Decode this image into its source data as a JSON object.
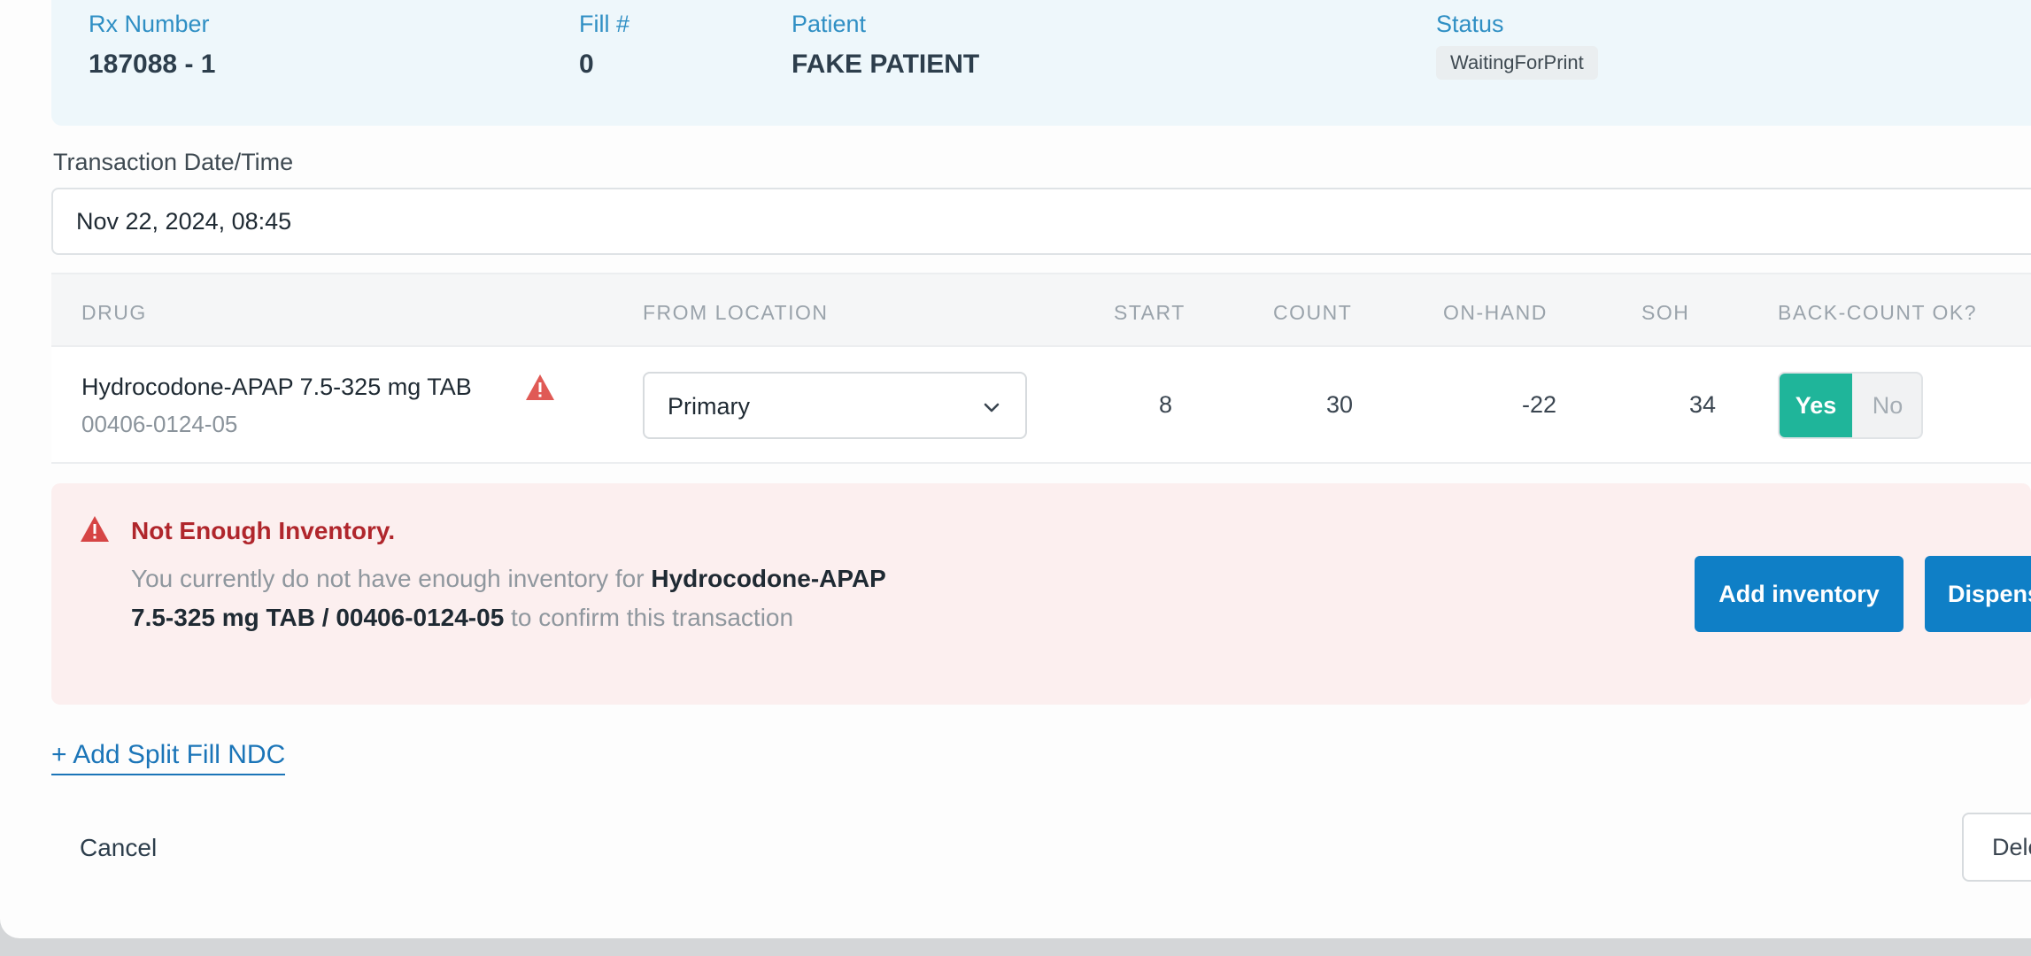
{
  "rx_header": {
    "rx_number_label": "Rx Number",
    "rx_number_value": "187088 - 1",
    "fill_label": "Fill #",
    "fill_value": "0",
    "patient_label": "Patient",
    "patient_value": "FAKE PATIENT",
    "status_label": "Status",
    "status_value": "WaitingForPrint"
  },
  "transaction": {
    "label": "Transaction Date/Time",
    "value": "Nov 22, 2024, 08:45"
  },
  "table": {
    "headers": [
      "DRUG",
      "FROM LOCATION",
      "START",
      "COUNT",
      "ON-HAND",
      "SOH",
      "BACK-COUNT OK?"
    ],
    "rows": [
      {
        "drug_name": "Hydrocodone-APAP 7.5-325 mg TAB",
        "ndc": "00406-0124-05",
        "from_location": "Primary",
        "start": "8",
        "count": "30",
        "on_hand": "-22",
        "soh": "34",
        "backcount_yes": "Yes",
        "backcount_no": "No",
        "backcount_selected": "Yes",
        "warning_icon": "warning-triangle-icon"
      }
    ]
  },
  "alert": {
    "title": "Not Enough Inventory.",
    "message_prefix": "You currently do not have enough inventory for ",
    "message_bold": "Hydrocodone-APAP 7.5-325 mg TAB / 00406-0124-05",
    "message_suffix": " to confirm this transaction",
    "add_inventory_label": "Add inventory",
    "dispense_label": "Dispense",
    "icon": "warning-triangle-icon"
  },
  "actions": {
    "add_split_label": "+ Add Split Fill NDC",
    "cancel_label": "Cancel",
    "delete_label": "Delete"
  },
  "colors": {
    "accent": "#0f7fc6",
    "success": "#1fb59a",
    "danger": "#b0262c",
    "header_bg": "#eef7fb",
    "alert_bg": "#fcefef"
  }
}
